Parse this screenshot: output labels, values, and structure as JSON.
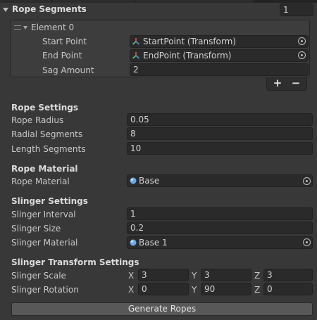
{
  "rope_segments": {
    "label": "Rope Segments",
    "count": "1",
    "element": {
      "label": "Element 0",
      "start_point": {
        "label": "Start Point",
        "value": "StartPoint (Transform)"
      },
      "end_point": {
        "label": "End Point",
        "value": "EndPoint (Transform)"
      },
      "sag_amount": {
        "label": "Sag Amount",
        "value": "2"
      }
    },
    "add_label": "+",
    "remove_label": "−"
  },
  "rope_settings": {
    "header": "Rope Settings",
    "rope_radius": {
      "label": "Rope Radius",
      "value": "0.05"
    },
    "radial_segments": {
      "label": "Radial Segments",
      "value": "8"
    },
    "length_segments": {
      "label": "Length Segments",
      "value": "10"
    }
  },
  "rope_material": {
    "header": "Rope Material",
    "material": {
      "label": "Rope Material",
      "value": "Base"
    }
  },
  "slinger_settings": {
    "header": "Slinger Settings",
    "interval": {
      "label": "Slinger Interval",
      "value": "1"
    },
    "size": {
      "label": "Slinger Size",
      "value": "0.2"
    },
    "material": {
      "label": "Slinger Material",
      "value": "Base 1"
    }
  },
  "slinger_transform": {
    "header": "Slinger Transform Settings",
    "scale": {
      "label": "Slinger Scale",
      "x": "3",
      "y": "3",
      "z": "3"
    },
    "rotation": {
      "label": "Slinger Rotation",
      "x": "0",
      "y": "90",
      "z": "0"
    },
    "axis_x": "X",
    "axis_y": "Y",
    "axis_z": "Z"
  },
  "generate_button": "Generate Ropes",
  "colors": {
    "background": "#383838",
    "field": "#2a2a2a",
    "transform_icon_red": "#e05050",
    "transform_icon_green": "#62c462",
    "transform_icon_blue": "#5a8de0",
    "material_icon": "#6aa8e8"
  },
  "icons": {
    "transform": "transform-icon",
    "material": "material-sphere-icon",
    "object_picker": "object-picker-icon",
    "foldout": "foldout-arrow-icon",
    "drag_handle": "drag-handle-icon"
  }
}
